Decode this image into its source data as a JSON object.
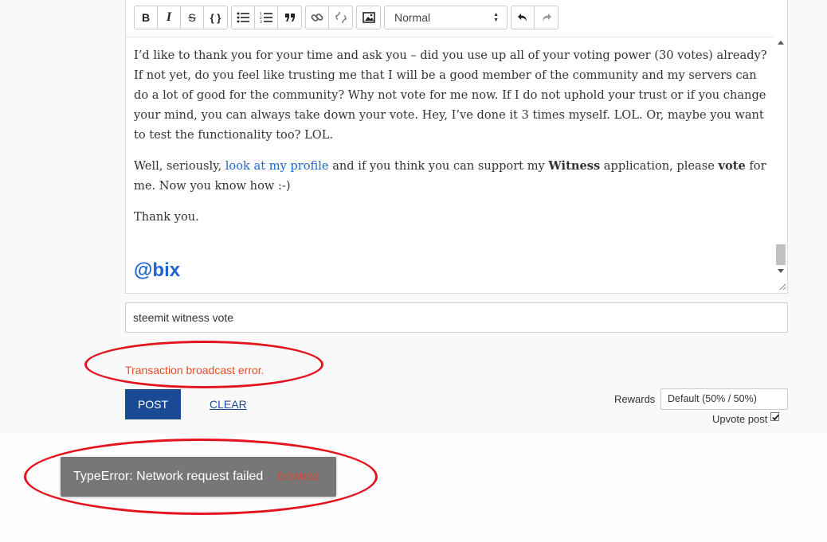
{
  "toolbar": {
    "buttons": {
      "bold": "B",
      "italic": "I",
      "strike": "S",
      "code": "{ }"
    },
    "heading_select": "Normal"
  },
  "editor": {
    "paragraph1": "I’d like to thank you for your time and ask you – did you use up all of your voting power (30 votes) already? If not yet, do you feel like trusting me that I will be a good member of the community and my servers can do a lot of good for the community?  Why not vote for me now.  If I do not uphold your trust or if you change your mind, you can always take down your vote.  Hey, I’ve done it 3 times myself. LOL. Or, maybe you want to test the functionality too? LOL.",
    "p2_part1": "Well, seriously, ",
    "p2_link": "look at my profile",
    "p2_part2": " and if you think you can support my ",
    "p2_bold1": "Witness",
    "p2_part3": " application, please ",
    "p2_bold2": "vote",
    "p2_part4": " for me. Now you know how :-)",
    "paragraph3": "Thank you.",
    "mention": "@bix"
  },
  "tags_value": "steemit witness vote",
  "error_text": "Transaction broadcast error.",
  "actions": {
    "post": "POST",
    "clear": "CLEAR"
  },
  "rewards": {
    "label": "Rewards",
    "selected": "Default (50% / 50%)"
  },
  "upvote_label": "Upvote post",
  "upvote_checked": true,
  "toast": {
    "message": "TypeError: Network request failed",
    "dismiss": "DISMISS"
  },
  "colors": {
    "link": "#1e64d2",
    "error": "#e44d26",
    "primary_button": "#1a4a93",
    "annotation_ring": "#e3141e",
    "toast_bg": "#777777"
  }
}
